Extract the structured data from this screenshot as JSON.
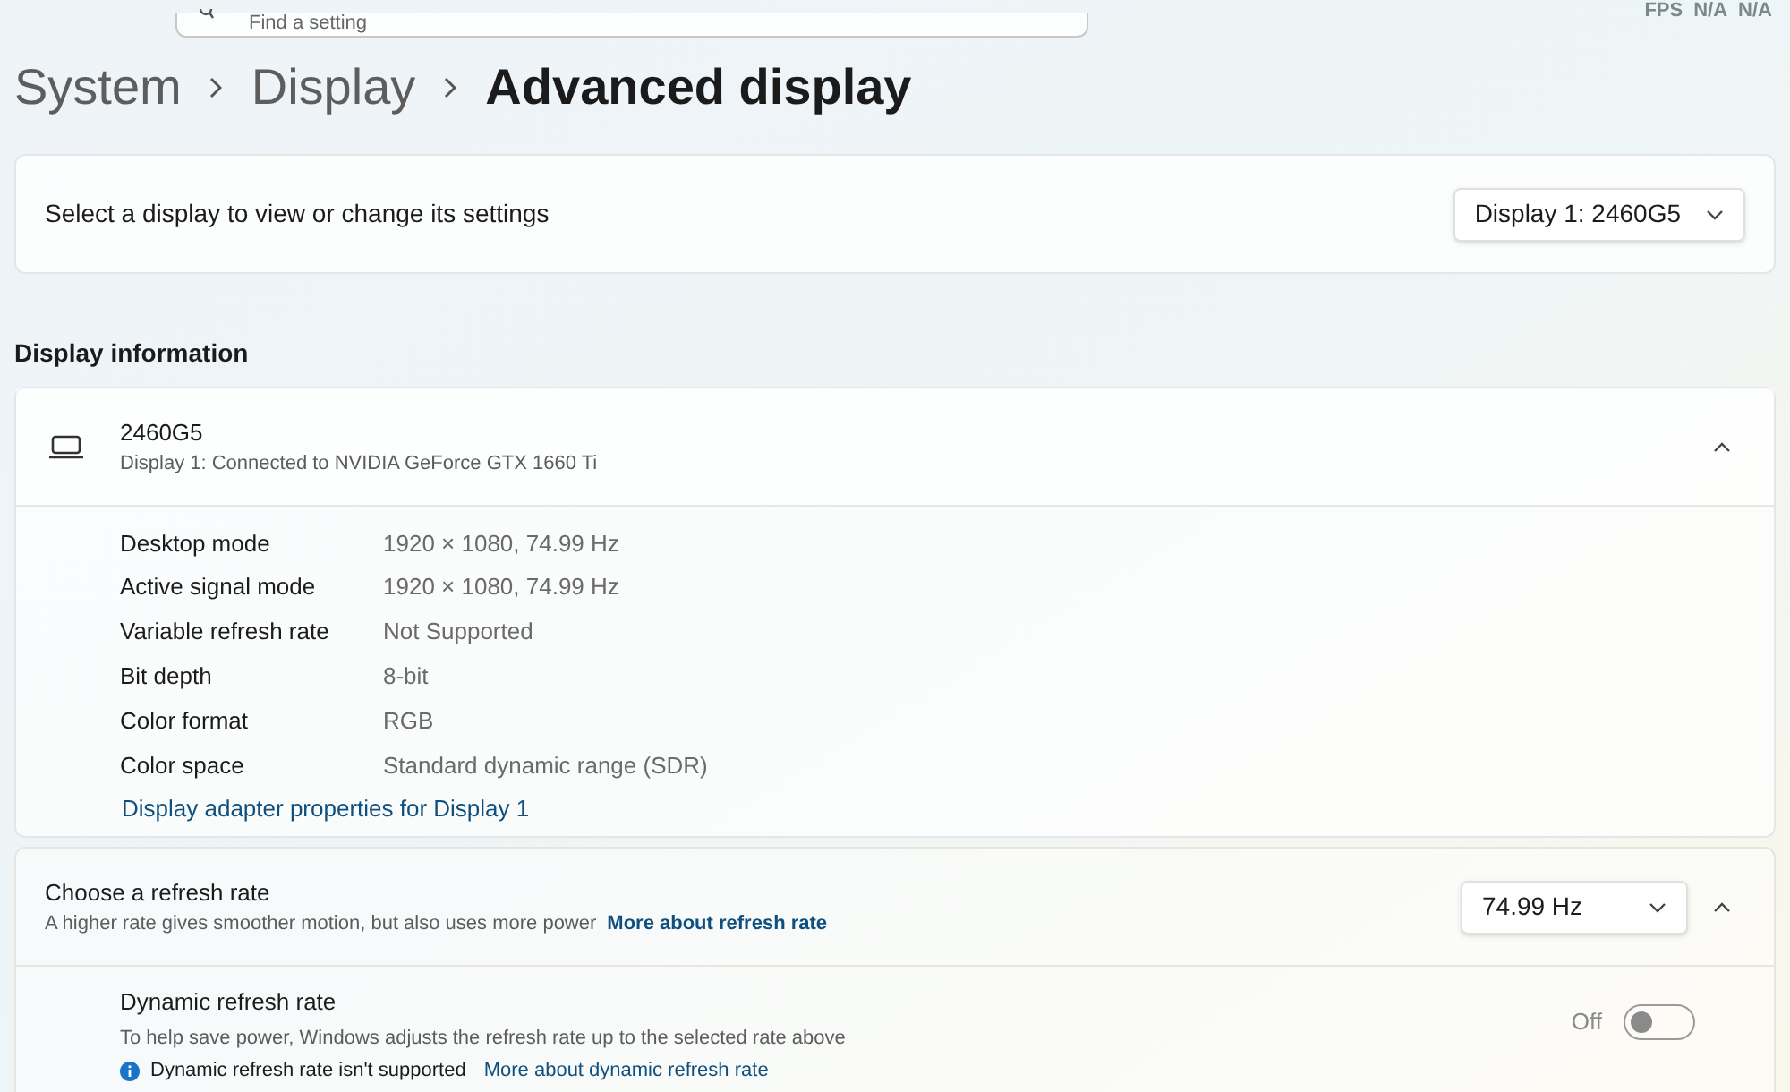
{
  "search": {
    "placeholder": "Find a setting"
  },
  "overlay": {
    "label": "FPS",
    "values": [
      "N/A",
      "N/A"
    ]
  },
  "breadcrumb": [
    {
      "label": "System",
      "selected": false
    },
    {
      "label": "Display",
      "selected": false
    },
    {
      "label": "Advanced display",
      "selected": true
    }
  ],
  "display_select": {
    "label": "Select a display to view or change its settings",
    "value": "Display 1: 2460G5"
  },
  "section_title": "Display information",
  "display_info": {
    "name": "2460G5",
    "subtitle": "Display 1: Connected to NVIDIA GeForce GTX 1660 Ti",
    "expanded": true,
    "rows": [
      {
        "label": "Desktop mode",
        "value": "1920 × 1080, 74.99 Hz"
      },
      {
        "label": "Active signal mode",
        "value": "1920 × 1080, 74.99 Hz"
      },
      {
        "label": "Variable refresh rate",
        "value": "Not Supported"
      },
      {
        "label": "Bit depth",
        "value": "8-bit"
      },
      {
        "label": "Color format",
        "value": "RGB"
      },
      {
        "label": "Color space",
        "value": "Standard dynamic range (SDR)"
      }
    ],
    "link": "Display adapter properties for Display 1"
  },
  "refresh_rate": {
    "title": "Choose a refresh rate",
    "description": "A higher rate gives smoother motion, but also uses more power",
    "link": "More about refresh rate",
    "value": "74.99 Hz",
    "expanded": true,
    "dynamic": {
      "title": "Dynamic refresh rate",
      "description": "To help save power, Windows adjusts the refresh rate up to the selected rate above",
      "note": "Dynamic refresh rate isn't supported",
      "note_link": "More about dynamic refresh rate",
      "state_label": "Off",
      "on": false
    }
  }
}
